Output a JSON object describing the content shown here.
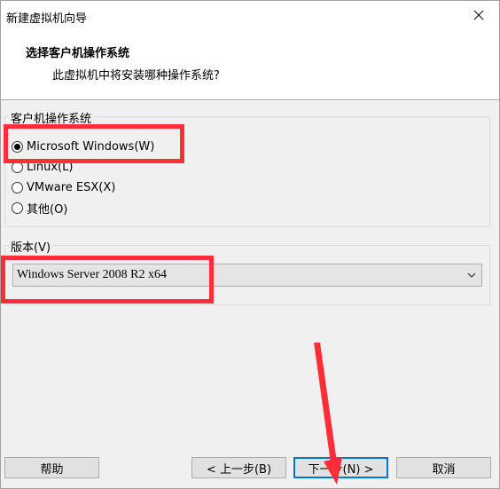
{
  "window": {
    "title": "新建虚拟机向导"
  },
  "header": {
    "title": "选择客户机操作系统",
    "subtitle": "此虚拟机中将安装哪种操作系统?"
  },
  "os_group": {
    "label": "客户机操作系统",
    "options": [
      {
        "label": "Microsoft Windows(W)",
        "checked": true
      },
      {
        "label": "Linux(L)",
        "checked": false
      },
      {
        "label": "VMware ESX(X)",
        "checked": false
      },
      {
        "label": "其他(O)",
        "checked": false
      }
    ]
  },
  "version_group": {
    "label": "版本(V)",
    "selected": "Windows Server 2008 R2 x64"
  },
  "buttons": {
    "help": "帮助",
    "back": "< 上一步(B)",
    "next": "下一步(N) >",
    "cancel": "取消"
  },
  "colors": {
    "highlight_red": "#ff2e36",
    "accent_blue": "#0078d7"
  }
}
